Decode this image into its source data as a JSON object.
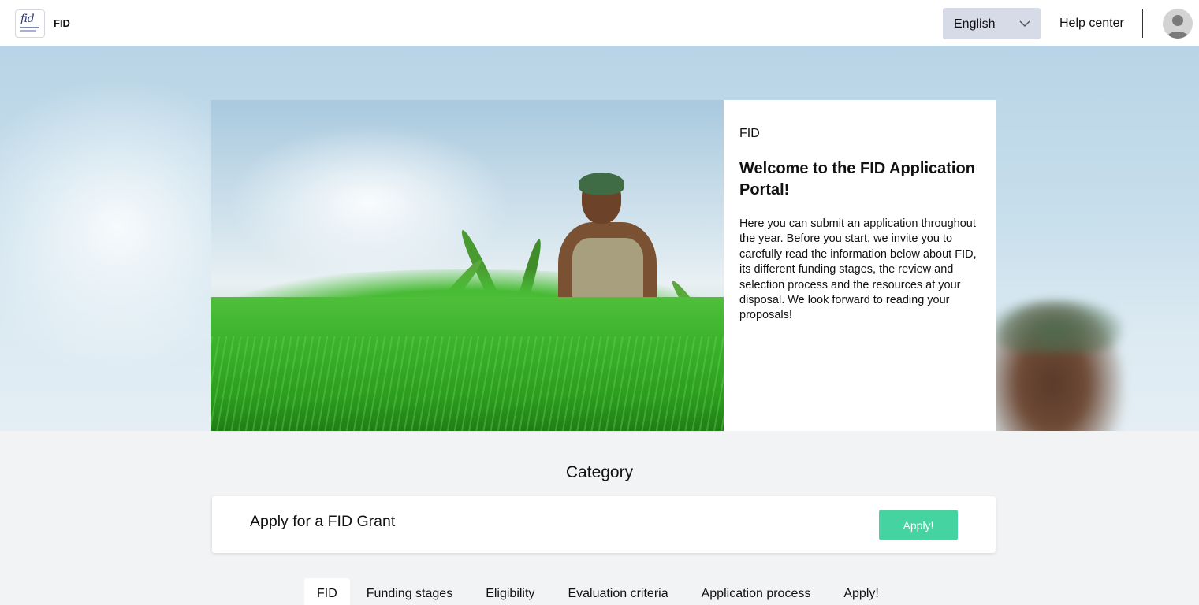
{
  "header": {
    "logo_label": "fid",
    "app_title": "FID",
    "language": {
      "selected": "English"
    },
    "help_label": "Help center"
  },
  "hero": {
    "eyebrow": "FID",
    "title": "Welcome to the FID Application Portal!",
    "body": "Here you can submit an application throughout the year. Before you start, we invite you to carefully read the information below about FID, its different funding stages, the review and selection process and the resources at your disposal. We look forward to reading your proposals!"
  },
  "category": {
    "heading": "Category",
    "items": [
      {
        "label": "Apply for a FID Grant",
        "button": "Apply!"
      }
    ]
  },
  "tabs": [
    {
      "label": "FID",
      "active": true
    },
    {
      "label": "Funding stages",
      "active": false
    },
    {
      "label": "Eligibility",
      "active": false
    },
    {
      "label": "Evaluation criteria",
      "active": false
    },
    {
      "label": "Application process",
      "active": false
    },
    {
      "label": "Apply!",
      "active": false
    }
  ],
  "colors": {
    "apply_button": "#45d3a2",
    "language_bg": "#d7dbe7",
    "logo": "#26376e"
  }
}
